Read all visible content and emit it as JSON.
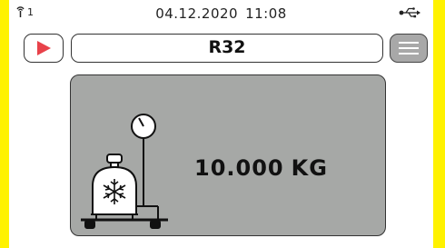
{
  "status": {
    "signal_count": "1",
    "date": "04.12.2020",
    "time": "11:08"
  },
  "header": {
    "title": "R32"
  },
  "display": {
    "weight_value": "10.000",
    "weight_unit": "KG"
  },
  "colors": {
    "frame": "#fff200",
    "play_accent": "#e8424a",
    "panel": "#a6a8a6",
    "menu_button": "#a8a8a8"
  },
  "icons": {
    "signal": "signal-icon",
    "usb": "usb-icon",
    "play": "play-icon",
    "menu": "menu-icon",
    "scale": "refrigerant-cylinder-scale-icon",
    "snowflake": "snowflake-icon"
  }
}
